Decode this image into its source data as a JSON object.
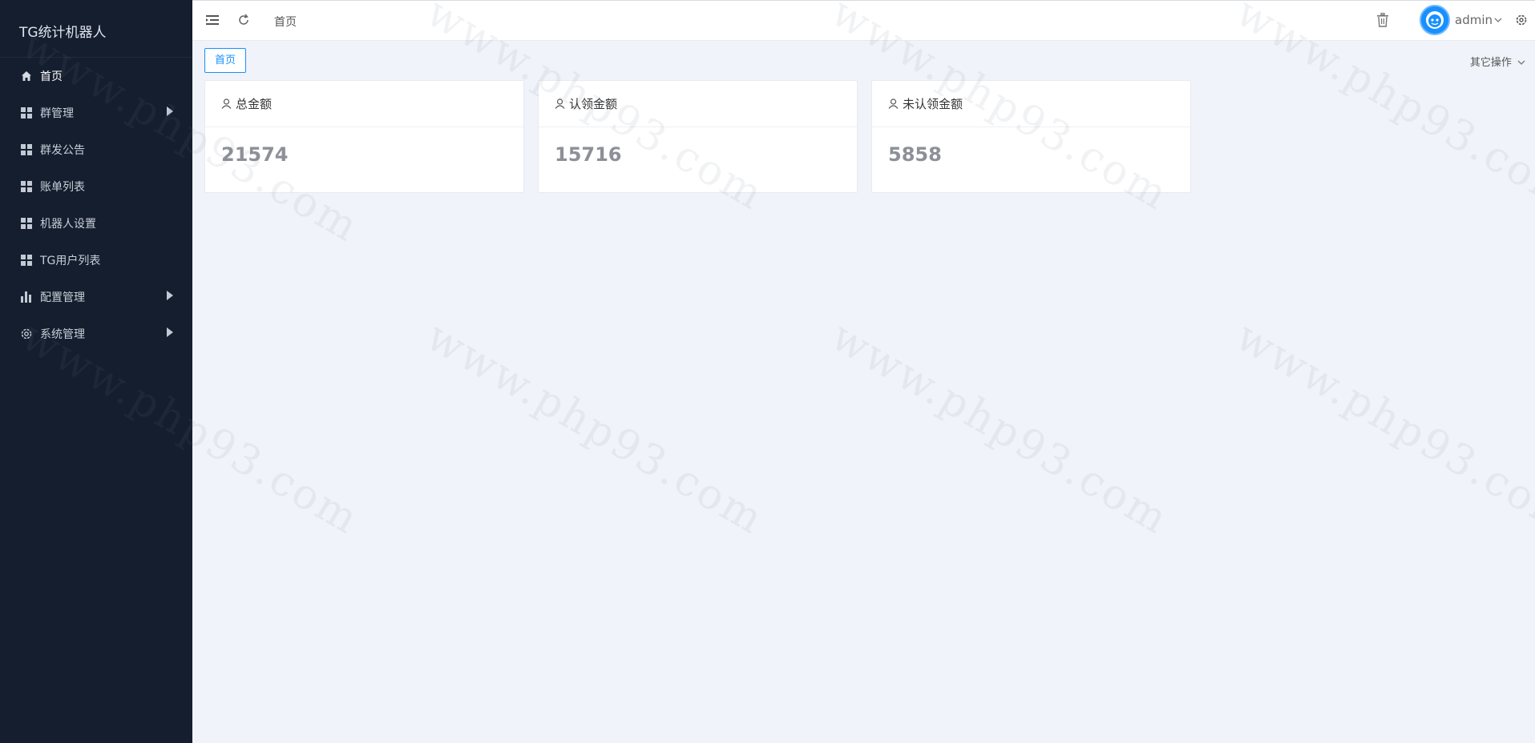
{
  "app": {
    "title": "TG统计机器人"
  },
  "sidebar": {
    "items": [
      {
        "label": "首页",
        "icon": "home-icon",
        "has_arrow": false
      },
      {
        "label": "群管理",
        "icon": "grid-icon",
        "has_arrow": true
      },
      {
        "label": "群发公告",
        "icon": "grid-icon",
        "has_arrow": false
      },
      {
        "label": "账单列表",
        "icon": "grid-icon",
        "has_arrow": false
      },
      {
        "label": "机器人设置",
        "icon": "grid-icon",
        "has_arrow": false
      },
      {
        "label": "TG用户列表",
        "icon": "grid-icon",
        "has_arrow": false
      },
      {
        "label": "配置管理",
        "icon": "bar-chart-icon",
        "has_arrow": true
      },
      {
        "label": "系统管理",
        "icon": "gear-icon",
        "has_arrow": true
      }
    ]
  },
  "header": {
    "breadcrumb": "首页",
    "username": "admin"
  },
  "tabs": {
    "active": "首页",
    "other_ops": "其它操作"
  },
  "cards": [
    {
      "title": "总金额",
      "value": "21574"
    },
    {
      "title": "认领金额",
      "value": "15716"
    },
    {
      "title": "未认领金额",
      "value": "5858"
    }
  ],
  "watermark": "www.php93.com",
  "colors": {
    "sidebar_bg": "#141e2e",
    "accent": "#1890ff",
    "page_bg": "#f0f3f9"
  }
}
